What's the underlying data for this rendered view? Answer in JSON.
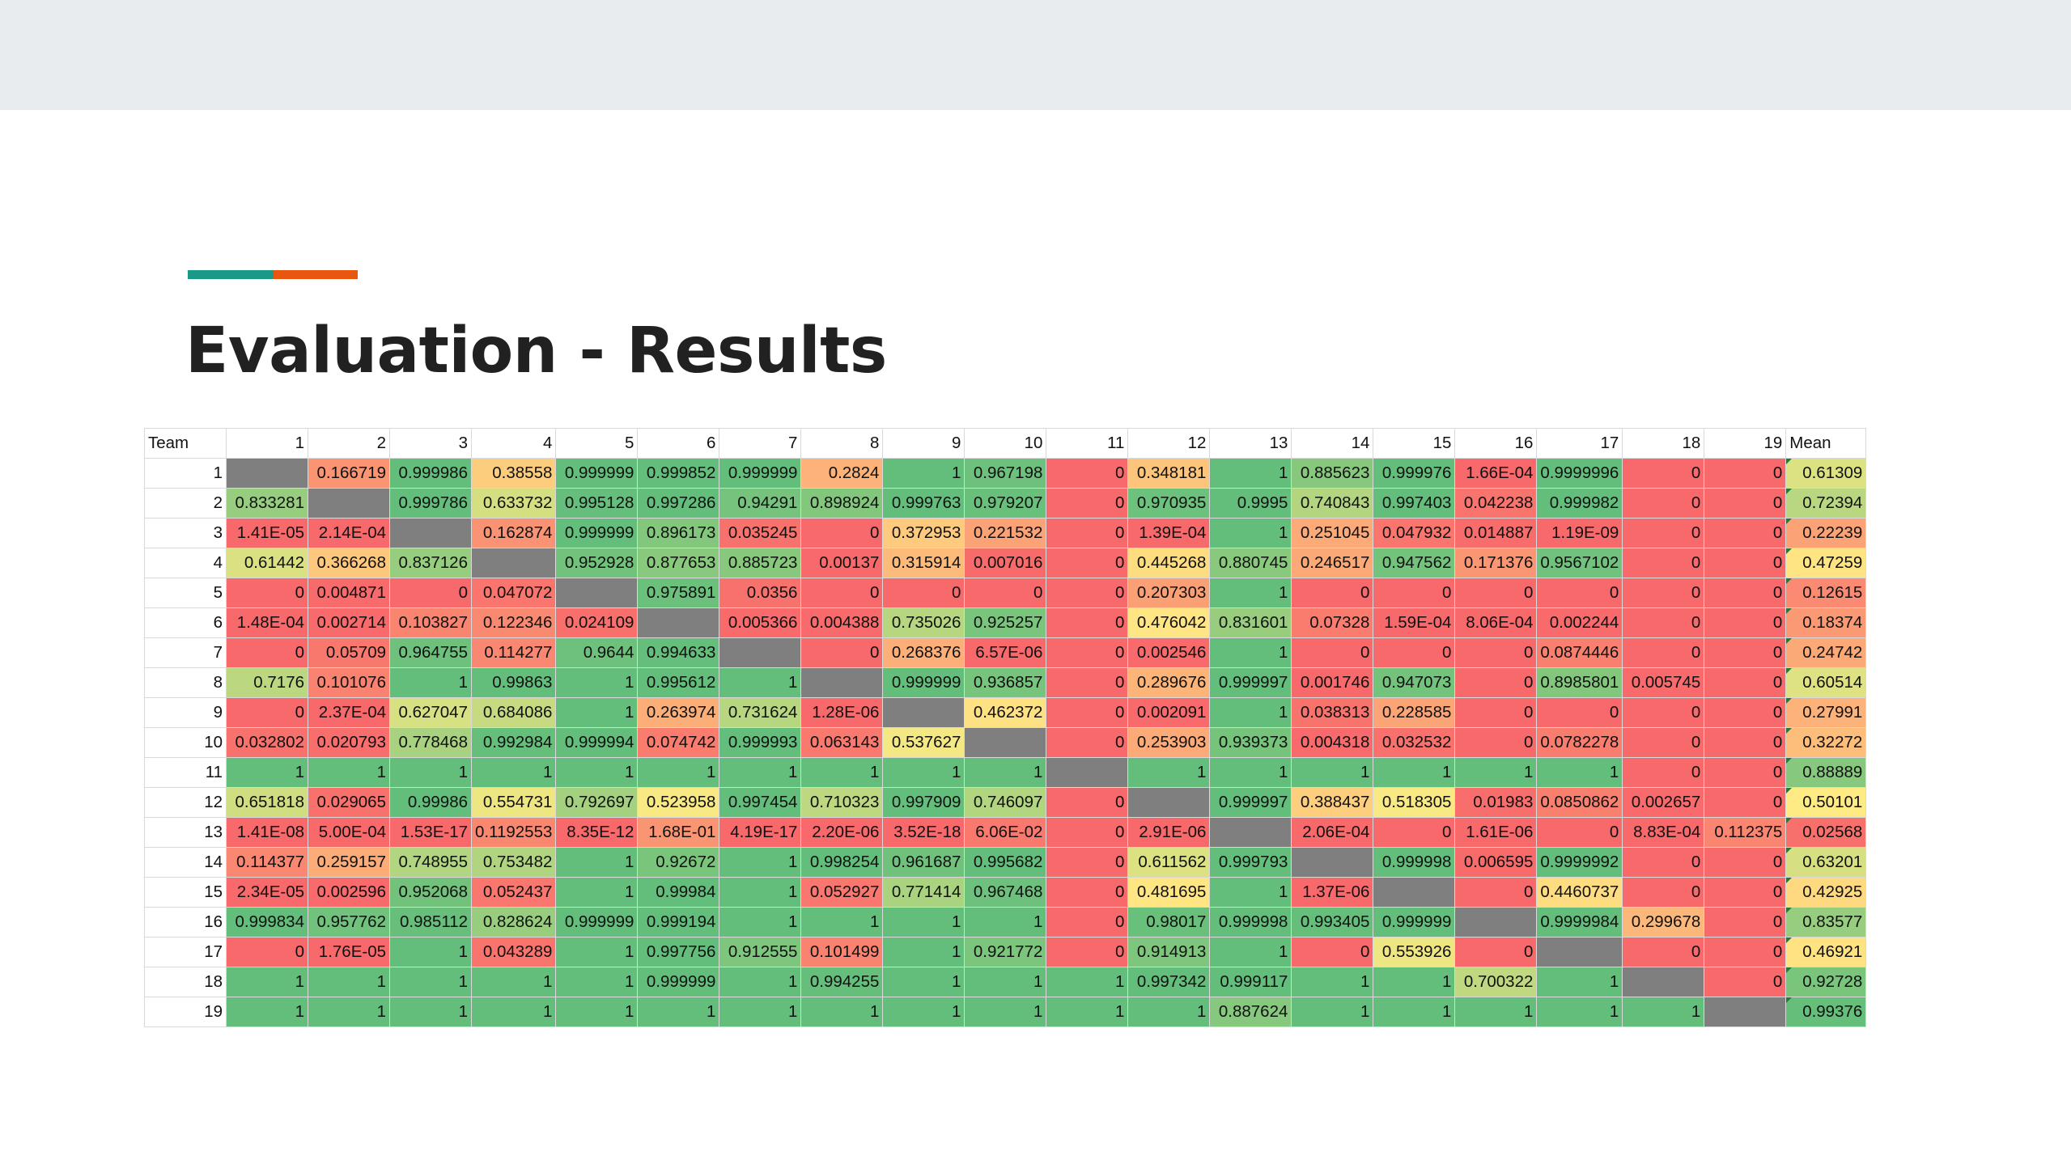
{
  "slide": {
    "title": "Evaluation - Results"
  },
  "colors": {
    "accent_teal": "#1a9988",
    "accent_orange": "#e8560f",
    "topbar": "#e8ecee",
    "diagonal": "#7f7f7f",
    "scale_low": "#f8696b",
    "scale_mid": "#ffeb84",
    "scale_high": "#63be7b"
  },
  "chart_data": {
    "type": "heatmap",
    "title": "",
    "header_label": "Team",
    "mean_label": "Mean",
    "columns": [
      "1",
      "2",
      "3",
      "4",
      "5",
      "6",
      "7",
      "8",
      "9",
      "10",
      "11",
      "12",
      "13",
      "14",
      "15",
      "16",
      "17",
      "18",
      "19"
    ],
    "rows": [
      {
        "team": "1",
        "cells": [
          null,
          "0.166719",
          "0.999986",
          "0.38558",
          "0.999999",
          "0.999852",
          "0.999999",
          "0.2824",
          "1",
          "0.967198",
          "0",
          "0.348181",
          "1",
          "0.885623",
          "0.999976",
          "1.66E-04",
          "0.9999996",
          "0",
          "0"
        ],
        "mean": "0.61309"
      },
      {
        "team": "2",
        "cells": [
          "0.833281",
          null,
          "0.999786",
          "0.633732",
          "0.995128",
          "0.997286",
          "0.94291",
          "0.898924",
          "0.999763",
          "0.979207",
          "0",
          "0.970935",
          "0.9995",
          "0.740843",
          "0.997403",
          "0.042238",
          "0.999982",
          "0",
          "0"
        ],
        "mean": "0.72394"
      },
      {
        "team": "3",
        "cells": [
          "1.41E-05",
          "2.14E-04",
          null,
          "0.162874",
          "0.999999",
          "0.896173",
          "0.035245",
          "0",
          "0.372953",
          "0.221532",
          "0",
          "1.39E-04",
          "1",
          "0.251045",
          "0.047932",
          "0.014887",
          "1.19E-09",
          "0",
          "0"
        ],
        "mean": "0.22239"
      },
      {
        "team": "4",
        "cells": [
          "0.61442",
          "0.366268",
          "0.837126",
          null,
          "0.952928",
          "0.877653",
          "0.885723",
          "0.00137",
          "0.315914",
          "0.007016",
          "0",
          "0.445268",
          "0.880745",
          "0.246517",
          "0.947562",
          "0.171376",
          "0.9567102",
          "0",
          "0"
        ],
        "mean": "0.47259"
      },
      {
        "team": "5",
        "cells": [
          "0",
          "0.004871",
          "0",
          "0.047072",
          null,
          "0.975891",
          "0.0356",
          "0",
          "0",
          "0",
          "0",
          "0.207303",
          "1",
          "0",
          "0",
          "0",
          "0",
          "0",
          "0"
        ],
        "mean": "0.12615"
      },
      {
        "team": "6",
        "cells": [
          "1.48E-04",
          "0.002714",
          "0.103827",
          "0.122346",
          "0.024109",
          null,
          "0.005366",
          "0.004388",
          "0.735026",
          "0.925257",
          "0",
          "0.476042",
          "0.831601",
          "0.07328",
          "1.59E-04",
          "8.06E-04",
          "0.002244",
          "0",
          "0"
        ],
        "mean": "0.18374"
      },
      {
        "team": "7",
        "cells": [
          "0",
          "0.05709",
          "0.964755",
          "0.114277",
          "0.9644",
          "0.994633",
          null,
          "0",
          "0.268376",
          "6.57E-06",
          "0",
          "0.002546",
          "1",
          "0",
          "0",
          "0",
          "0.0874446",
          "0",
          "0"
        ],
        "mean": "0.24742"
      },
      {
        "team": "8",
        "cells": [
          "0.7176",
          "0.101076",
          "1",
          "0.99863",
          "1",
          "0.995612",
          "1",
          null,
          "0.999999",
          "0.936857",
          "0",
          "0.289676",
          "0.999997",
          "0.001746",
          "0.947073",
          "0",
          "0.8985801",
          "0.005745",
          "0"
        ],
        "mean": "0.60514"
      },
      {
        "team": "9",
        "cells": [
          "0",
          "2.37E-04",
          "0.627047",
          "0.684086",
          "1",
          "0.263974",
          "0.731624",
          "1.28E-06",
          null,
          "0.462372",
          "0",
          "0.002091",
          "1",
          "0.038313",
          "0.228585",
          "0",
          "0",
          "0",
          "0"
        ],
        "mean": "0.27991"
      },
      {
        "team": "10",
        "cells": [
          "0.032802",
          "0.020793",
          "0.778468",
          "0.992984",
          "0.999994",
          "0.074742",
          "0.999993",
          "0.063143",
          "0.537627",
          null,
          "0",
          "0.253903",
          "0.939373",
          "0.004318",
          "0.032532",
          "0",
          "0.0782278",
          "0",
          "0"
        ],
        "mean": "0.32272"
      },
      {
        "team": "11",
        "cells": [
          "1",
          "1",
          "1",
          "1",
          "1",
          "1",
          "1",
          "1",
          "1",
          "1",
          null,
          "1",
          "1",
          "1",
          "1",
          "1",
          "1",
          "0",
          "0"
        ],
        "mean": "0.88889"
      },
      {
        "team": "12",
        "cells": [
          "0.651818",
          "0.029065",
          "0.99986",
          "0.554731",
          "0.792697",
          "0.523958",
          "0.997454",
          "0.710323",
          "0.997909",
          "0.746097",
          "0",
          null,
          "0.999997",
          "0.388437",
          "0.518305",
          "0.01983",
          "0.0850862",
          "0.002657",
          "0"
        ],
        "mean": "0.50101"
      },
      {
        "team": "13",
        "cells": [
          "1.41E-08",
          "5.00E-04",
          "1.53E-17",
          "0.1192553",
          "8.35E-12",
          "1.68E-01",
          "4.19E-17",
          "2.20E-06",
          "3.52E-18",
          "6.06E-02",
          "0",
          "2.91E-06",
          null,
          "2.06E-04",
          "0",
          "1.61E-06",
          "0",
          "8.83E-04",
          "0.112375"
        ],
        "mean": "0.02568"
      },
      {
        "team": "14",
        "cells": [
          "0.114377",
          "0.259157",
          "0.748955",
          "0.753482",
          "1",
          "0.92672",
          "1",
          "0.998254",
          "0.961687",
          "0.995682",
          "0",
          "0.611562",
          "0.999793",
          null,
          "0.999998",
          "0.006595",
          "0.9999992",
          "0",
          "0"
        ],
        "mean": "0.63201"
      },
      {
        "team": "15",
        "cells": [
          "2.34E-05",
          "0.002596",
          "0.952068",
          "0.052437",
          "1",
          "0.99984",
          "1",
          "0.052927",
          "0.771414",
          "0.967468",
          "0",
          "0.481695",
          "1",
          "1.37E-06",
          null,
          "0",
          "0.4460737",
          "0",
          "0"
        ],
        "mean": "0.42925"
      },
      {
        "team": "16",
        "cells": [
          "0.999834",
          "0.957762",
          "0.985112",
          "0.828624",
          "0.999999",
          "0.999194",
          "1",
          "1",
          "1",
          "1",
          "0",
          "0.98017",
          "0.999998",
          "0.993405",
          "0.999999",
          null,
          "0.9999984",
          "0.299678",
          "0"
        ],
        "mean": "0.83577"
      },
      {
        "team": "17",
        "cells": [
          "0",
          "1.76E-05",
          "1",
          "0.043289",
          "1",
          "0.997756",
          "0.912555",
          "0.101499",
          "1",
          "0.921772",
          "0",
          "0.914913",
          "1",
          "0",
          "0.553926",
          "0",
          null,
          "0",
          "0"
        ],
        "mean": "0.46921"
      },
      {
        "team": "18",
        "cells": [
          "1",
          "1",
          "1",
          "1",
          "1",
          "0.999999",
          "1",
          "0.994255",
          "1",
          "1",
          "1",
          "0.997342",
          "0.999117",
          "1",
          "1",
          "0.700322",
          "1",
          null,
          "0"
        ],
        "mean": "0.92728"
      },
      {
        "team": "19",
        "cells": [
          "1",
          "1",
          "1",
          "1",
          "1",
          "1",
          "1",
          "1",
          "1",
          "1",
          "1",
          "1",
          "0.887624",
          "1",
          "1",
          "1",
          "1",
          "1",
          null
        ],
        "mean": "0.99376"
      }
    ]
  }
}
